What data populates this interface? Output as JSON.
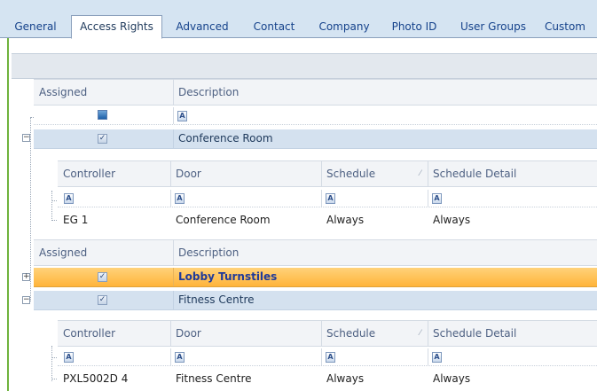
{
  "tabs": [
    {
      "label": "General",
      "active": false
    },
    {
      "label": "Access Rights",
      "active": true
    },
    {
      "label": "Advanced",
      "active": false
    },
    {
      "label": "Contact",
      "active": false
    },
    {
      "label": "Company",
      "active": false
    },
    {
      "label": "Photo ID",
      "active": false
    },
    {
      "label": "User Groups",
      "active": false
    },
    {
      "label": "Custom",
      "active": false
    }
  ],
  "master_columns": {
    "assigned": "Assigned",
    "description": "Description"
  },
  "detail_columns": {
    "controller": "Controller",
    "door": "Door",
    "schedule": "Schedule",
    "schedule_detail": "Schedule Detail"
  },
  "filter_glyph": "A",
  "check_glyph": "✓",
  "expand_collapsed": "+",
  "expand_expanded": "−",
  "groups": [
    {
      "description": "Conference Room",
      "assigned": true,
      "expanded": true,
      "detail_rows": [
        {
          "controller": "EG 1",
          "door": "Conference Room",
          "schedule": "Always",
          "schedule_detail": "Always"
        }
      ]
    },
    {
      "description": "Lobby Turnstiles",
      "assigned": true,
      "expanded": false,
      "highlighted": true
    },
    {
      "description": "Fitness Centre",
      "assigned": true,
      "expanded": true,
      "detail_rows": [
        {
          "controller": "PXL5002D 4",
          "door": "Fitness Centre",
          "schedule": "Always",
          "schedule_detail": "Always"
        }
      ]
    }
  ],
  "colors": {
    "accent_green": "#6fb33d",
    "highlight_orange": "#ffb43a",
    "selected_blue": "#d4e1ef"
  }
}
